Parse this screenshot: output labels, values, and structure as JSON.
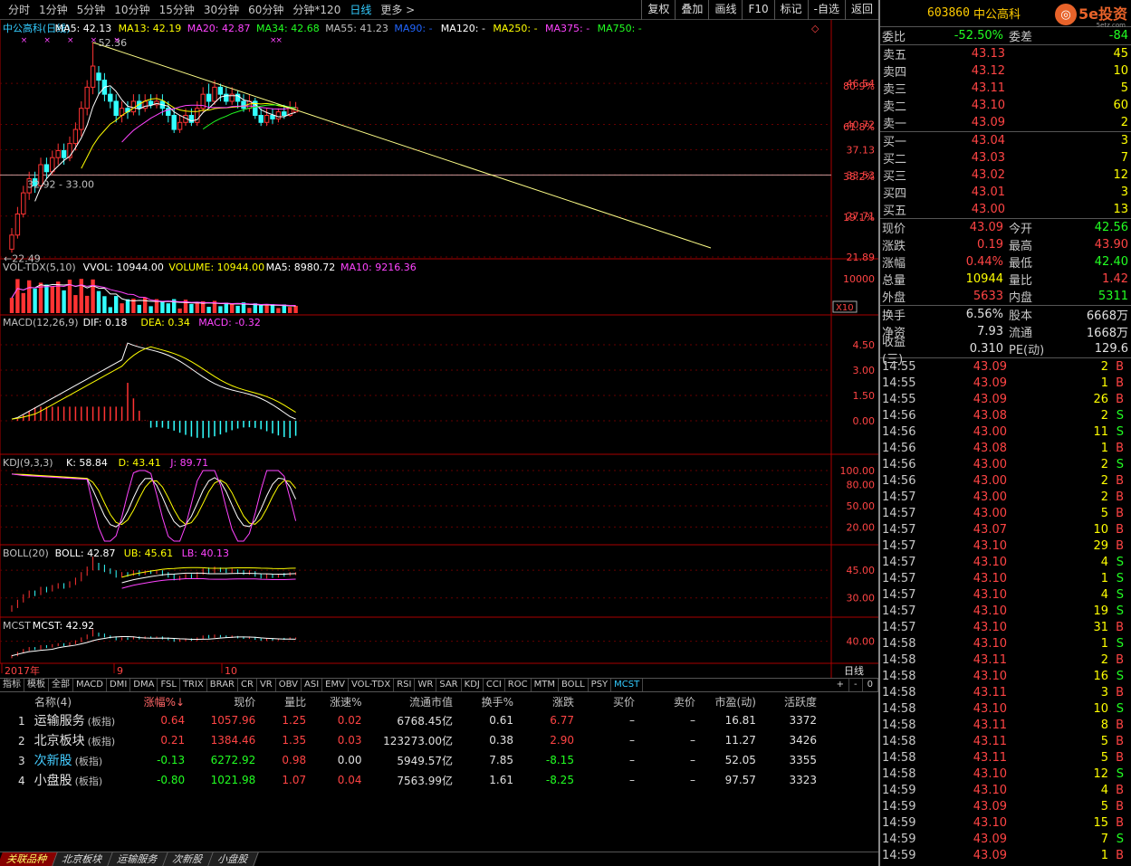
{
  "periods": [
    "分时",
    "1分钟",
    "5分钟",
    "10分钟",
    "15分钟",
    "30分钟",
    "60分钟",
    "分钟*120",
    "日线",
    "更多 >"
  ],
  "active_period": "日线",
  "tools": [
    "复权",
    "叠加",
    "画线",
    "F10",
    "标记",
    "-自选",
    "返回"
  ],
  "main": {
    "legend": [
      {
        "t": "中公高科(日线)",
        "c": "#33ccff"
      },
      {
        "t": "MA5: 42.13",
        "c": "#ffffff"
      },
      {
        "t": "MA13: 42.19",
        "c": "#ffff00"
      },
      {
        "t": "MA20: 42.87",
        "c": "#ff44ff"
      },
      {
        "t": "MA34: 42.68",
        "c": "#22ff22"
      },
      {
        "t": "MA55: 41.23",
        "c": "#c0c0c0"
      },
      {
        "t": "MA90: -",
        "c": "#2266ff"
      },
      {
        "t": "MA120: -",
        "c": "#ffffff"
      },
      {
        "t": "MA250: -",
        "c": "#ffff00"
      },
      {
        "t": "MA375: -",
        "c": "#ff44ff"
      },
      {
        "t": "MA750: -",
        "c": "#22ff22"
      }
    ],
    "high_label": "52.36",
    "low_label": "←22.49",
    "range_label": "32.92 - 33.00",
    "price_ticks": [
      "46.54",
      "40.72",
      "37.13",
      "33.53",
      "27.71",
      "21.89"
    ],
    "pct_ticks": [
      "80.9%",
      "61.8%",
      "38.2%",
      "19.1%"
    ],
    "candles": [
      {
        "o": 23,
        "c": 25,
        "h": 26,
        "l": 22.5
      },
      {
        "o": 25,
        "c": 28,
        "h": 29,
        "l": 24.5
      },
      {
        "o": 28,
        "c": 31,
        "h": 32,
        "l": 27.5
      },
      {
        "o": 31,
        "c": 33,
        "h": 34,
        "l": 30
      },
      {
        "o": 33,
        "c": 32,
        "h": 34,
        "l": 31
      },
      {
        "o": 32,
        "c": 35,
        "h": 36,
        "l": 31.5
      },
      {
        "o": 35,
        "c": 34,
        "h": 36,
        "l": 33
      },
      {
        "o": 34,
        "c": 36,
        "h": 37,
        "l": 33.5
      },
      {
        "o": 36,
        "c": 37,
        "h": 38,
        "l": 35
      },
      {
        "o": 37,
        "c": 36,
        "h": 38,
        "l": 35
      },
      {
        "o": 36,
        "c": 38,
        "h": 39,
        "l": 35.5
      },
      {
        "o": 38,
        "c": 40,
        "h": 41,
        "l": 37
      },
      {
        "o": 40,
        "c": 43,
        "h": 44,
        "l": 39
      },
      {
        "o": 43,
        "c": 46,
        "h": 47,
        "l": 42
      },
      {
        "o": 46,
        "c": 49,
        "h": 52.36,
        "l": 45
      },
      {
        "o": 48,
        "c": 47,
        "h": 49,
        "l": 45
      },
      {
        "o": 47,
        "c": 45,
        "h": 48,
        "l": 44
      },
      {
        "o": 45,
        "c": 44,
        "h": 46,
        "l": 43
      },
      {
        "o": 44,
        "c": 42,
        "h": 45,
        "l": 41
      },
      {
        "o": 42,
        "c": 43,
        "h": 44,
        "l": 41
      },
      {
        "o": 43,
        "c": 42.5,
        "h": 44,
        "l": 41.5
      },
      {
        "o": 42.5,
        "c": 44,
        "h": 45,
        "l": 42
      },
      {
        "o": 44,
        "c": 43,
        "h": 45,
        "l": 42
      },
      {
        "o": 43,
        "c": 44,
        "h": 45,
        "l": 42.5
      },
      {
        "o": 44,
        "c": 43.5,
        "h": 45,
        "l": 43
      },
      {
        "o": 43.5,
        "c": 44,
        "h": 45,
        "l": 43
      },
      {
        "o": 44,
        "c": 43,
        "h": 45,
        "l": 42
      },
      {
        "o": 43,
        "c": 42,
        "h": 44,
        "l": 41
      },
      {
        "o": 42,
        "c": 40,
        "h": 43,
        "l": 39.5
      },
      {
        "o": 40,
        "c": 41,
        "h": 42,
        "l": 39.5
      },
      {
        "o": 41,
        "c": 42,
        "h": 43,
        "l": 40.5
      },
      {
        "o": 42,
        "c": 41,
        "h": 43,
        "l": 40.5
      },
      {
        "o": 41,
        "c": 43,
        "h": 44,
        "l": 40.5
      },
      {
        "o": 43,
        "c": 45,
        "h": 46,
        "l": 42.5
      },
      {
        "o": 45,
        "c": 44,
        "h": 46.5,
        "l": 43
      },
      {
        "o": 44,
        "c": 46,
        "h": 47,
        "l": 43.5
      },
      {
        "o": 46,
        "c": 45,
        "h": 46.5,
        "l": 44
      },
      {
        "o": 45,
        "c": 44,
        "h": 46,
        "l": 43.5
      },
      {
        "o": 44,
        "c": 45,
        "h": 46,
        "l": 43.5
      },
      {
        "o": 45,
        "c": 44,
        "h": 45.5,
        "l": 43
      },
      {
        "o": 44,
        "c": 43,
        "h": 45,
        "l": 42.5
      },
      {
        "o": 43,
        "c": 44,
        "h": 45,
        "l": 42.5
      },
      {
        "o": 44,
        "c": 42,
        "h": 44.5,
        "l": 41.5
      },
      {
        "o": 42,
        "c": 41,
        "h": 43,
        "l": 40.5
      },
      {
        "o": 41,
        "c": 42,
        "h": 43,
        "l": 40.5
      },
      {
        "o": 42,
        "c": 41.5,
        "h": 43,
        "l": 40.8
      },
      {
        "o": 41.5,
        "c": 42.5,
        "h": 43,
        "l": 41
      },
      {
        "o": 42.5,
        "c": 42,
        "h": 43.5,
        "l": 41.5
      },
      {
        "o": 42,
        "c": 43,
        "h": 44,
        "l": 41.8
      },
      {
        "o": 42.5,
        "c": 43.09,
        "h": 43.9,
        "l": 42.4
      }
    ]
  },
  "vol": {
    "legend": [
      {
        "t": "VOL-TDX(5,10)",
        "c": "#c0c0c0"
      },
      {
        "t": "VVOL: 10944.00",
        "c": "#ffffff"
      },
      {
        "t": "VOLUME: 10944.00",
        "c": "#ffff00"
      },
      {
        "t": "MA5: 8980.72",
        "c": "#ffffff"
      },
      {
        "t": "MA10: 9216.36",
        "c": "#ff44ff"
      }
    ],
    "tick": "10000",
    "scale": "X10"
  },
  "macd": {
    "legend": [
      {
        "t": "MACD(12,26,9)",
        "c": "#c0c0c0"
      },
      {
        "t": "DIF: 0.18",
        "c": "#ffffff"
      },
      {
        "t": "DEA: 0.34",
        "c": "#ffff00"
      },
      {
        "t": "MACD: -0.32",
        "c": "#ff44ff"
      }
    ],
    "ticks": [
      "4.50",
      "3.00",
      "1.50",
      "0.00"
    ]
  },
  "kdj": {
    "legend": [
      {
        "t": "KDJ(9,3,3)",
        "c": "#c0c0c0"
      },
      {
        "t": "K: 58.84",
        "c": "#ffffff"
      },
      {
        "t": "D: 43.41",
        "c": "#ffff00"
      },
      {
        "t": "J: 89.71",
        "c": "#ff44ff"
      }
    ],
    "ticks": [
      "100.00",
      "80.00",
      "50.00",
      "20.00"
    ]
  },
  "boll": {
    "legend": [
      {
        "t": "BOLL(20)",
        "c": "#c0c0c0"
      },
      {
        "t": "BOLL: 42.87",
        "c": "#ffffff"
      },
      {
        "t": "UB: 45.61",
        "c": "#ffff00"
      },
      {
        "t": "LB: 40.13",
        "c": "#ff44ff"
      }
    ],
    "ticks": [
      "45.00",
      "30.00"
    ]
  },
  "mcst": {
    "legend": [
      {
        "t": "MCST",
        "c": "#c0c0c0"
      },
      {
        "t": "MCST: 42.92",
        "c": "#ffffff"
      }
    ],
    "ticks": [
      "40.00"
    ]
  },
  "xaxis": {
    "labels": [
      "2017年",
      "9",
      "10"
    ],
    "right": "日线"
  },
  "indicator_tabs": [
    "指标",
    "模板",
    "全部",
    "MACD",
    "DMI",
    "DMA",
    "FSL",
    "TRIX",
    "BRAR",
    "CR",
    "VR",
    "OBV",
    "ASI",
    "EMV",
    "VOL-TDX",
    "RSI",
    "WR",
    "SAR",
    "KDJ",
    "CCI",
    "ROC",
    "MTM",
    "BOLL",
    "PSY",
    "MCST"
  ],
  "active_indicator": "MCST",
  "tab_controls": [
    "+",
    "-",
    "0"
  ],
  "blocks": {
    "headers": [
      "名称(4)",
      "涨幅%↓",
      "现价",
      "量比",
      "涨速%",
      "流通市值",
      "换手%",
      "涨跌",
      "买价",
      "卖价",
      "市盈(动)",
      "活跃度"
    ],
    "rows": [
      {
        "no": "1",
        "name": "运输服务",
        "tag": "(板指)",
        "chg": "0.64",
        "price": "1057.96",
        "vr": "1.25",
        "speed": "0.02",
        "mcap": "6768.45亿",
        "turn": "0.61",
        "diff": "6.77",
        "bid": "–",
        "ask": "–",
        "pe": "16.81",
        "act": "3372",
        "dir": "up"
      },
      {
        "no": "2",
        "name": "北京板块",
        "tag": "(板指)",
        "chg": "0.21",
        "price": "1384.46",
        "vr": "1.35",
        "speed": "0.03",
        "mcap": "123273.00亿",
        "turn": "0.38",
        "diff": "2.90",
        "bid": "–",
        "ask": "–",
        "pe": "11.27",
        "act": "3426",
        "dir": "up"
      },
      {
        "no": "3",
        "name": "次新股",
        "tag": "(板指)",
        "chg": "-0.13",
        "price": "6272.92",
        "vr": "0.98",
        "speed": "0.00",
        "mcap": "5949.57亿",
        "turn": "7.85",
        "diff": "-8.15",
        "bid": "–",
        "ask": "–",
        "pe": "52.05",
        "act": "3355",
        "dir": "down"
      },
      {
        "no": "4",
        "name": "小盘股",
        "tag": "(板指)",
        "chg": "-0.80",
        "price": "1021.98",
        "vr": "1.07",
        "speed": "0.04",
        "mcap": "7563.99亿",
        "turn": "1.61",
        "diff": "-8.25",
        "bid": "–",
        "ask": "–",
        "pe": "97.57",
        "act": "3323",
        "dir": "down"
      }
    ]
  },
  "bottom_tabs": [
    "关联品种",
    "北京板块",
    "运输服务",
    "次新股",
    "小盘股"
  ],
  "stock": {
    "code": "603860",
    "name": "中公高科",
    "logo": "5e投资",
    "logo_sub": "5etz.com",
    "ratio": {
      "l": "委比",
      "v": "-52.50%",
      "l2": "委差",
      "v2": "-84"
    },
    "asks": [
      {
        "l": "卖五",
        "p": "43.13",
        "n": "45"
      },
      {
        "l": "卖四",
        "p": "43.12",
        "n": "10"
      },
      {
        "l": "卖三",
        "p": "43.11",
        "n": "5"
      },
      {
        "l": "卖二",
        "p": "43.10",
        "n": "60"
      },
      {
        "l": "卖一",
        "p": "43.09",
        "n": "2"
      }
    ],
    "bids": [
      {
        "l": "买一",
        "p": "43.04",
        "n": "3"
      },
      {
        "l": "买二",
        "p": "43.03",
        "n": "7"
      },
      {
        "l": "买三",
        "p": "43.02",
        "n": "12"
      },
      {
        "l": "买四",
        "p": "43.01",
        "n": "3"
      },
      {
        "l": "买五",
        "p": "43.00",
        "n": "13"
      }
    ],
    "quote": [
      {
        "l": "现价",
        "v": "43.09",
        "vc": "red",
        "l2": "今开",
        "v2": "42.56",
        "v2c": "grn"
      },
      {
        "l": "涨跌",
        "v": "0.19",
        "vc": "red",
        "l2": "最高",
        "v2": "43.90",
        "v2c": "red"
      },
      {
        "l": "涨幅",
        "v": "0.44%",
        "vc": "red",
        "l2": "最低",
        "v2": "42.40",
        "v2c": "grn"
      },
      {
        "l": "总量",
        "v": "10944",
        "vc": "yel",
        "l2": "量比",
        "v2": "1.42",
        "v2c": "red"
      },
      {
        "l": "外盘",
        "v": "5633",
        "vc": "red",
        "l2": "内盘",
        "v2": "5311",
        "v2c": "grn"
      }
    ],
    "quote2": [
      {
        "l": "换手",
        "v": "6.56%",
        "vc": "wht",
        "l2": "股本",
        "v2": "6668万",
        "v2c": "wht"
      },
      {
        "l": "净资",
        "v": "7.93",
        "vc": "wht",
        "l2": "流通",
        "v2": "1668万",
        "v2c": "wht"
      },
      {
        "l": "收益(三)",
        "v": "0.310",
        "vc": "wht",
        "l2": "PE(动)",
        "v2": "129.6",
        "v2c": "wht"
      }
    ],
    "ticks": [
      [
        "14:55",
        "43.09",
        "2",
        "B"
      ],
      [
        "14:55",
        "43.09",
        "1",
        "B"
      ],
      [
        "14:55",
        "43.09",
        "26",
        "B"
      ],
      [
        "14:56",
        "43.08",
        "2",
        "S"
      ],
      [
        "14:56",
        "43.00",
        "11",
        "S"
      ],
      [
        "14:56",
        "43.08",
        "1",
        "B"
      ],
      [
        "14:56",
        "43.00",
        "2",
        "S"
      ],
      [
        "14:56",
        "43.00",
        "2",
        "B"
      ],
      [
        "14:57",
        "43.00",
        "2",
        "B"
      ],
      [
        "14:57",
        "43.00",
        "5",
        "B"
      ],
      [
        "14:57",
        "43.07",
        "10",
        "B"
      ],
      [
        "14:57",
        "43.10",
        "29",
        "B"
      ],
      [
        "14:57",
        "43.10",
        "4",
        "S"
      ],
      [
        "14:57",
        "43.10",
        "1",
        "S"
      ],
      [
        "14:57",
        "43.10",
        "4",
        "S"
      ],
      [
        "14:57",
        "43.10",
        "19",
        "S"
      ],
      [
        "14:57",
        "43.10",
        "31",
        "B"
      ],
      [
        "14:58",
        "43.10",
        "1",
        "S"
      ],
      [
        "14:58",
        "43.11",
        "2",
        "B"
      ],
      [
        "14:58",
        "43.10",
        "16",
        "S"
      ],
      [
        "14:58",
        "43.11",
        "3",
        "B"
      ],
      [
        "14:58",
        "43.10",
        "10",
        "S"
      ],
      [
        "14:58",
        "43.11",
        "8",
        "B"
      ],
      [
        "14:58",
        "43.11",
        "5",
        "B"
      ],
      [
        "14:58",
        "43.11",
        "5",
        "B"
      ],
      [
        "14:58",
        "43.10",
        "12",
        "S"
      ],
      [
        "14:59",
        "43.10",
        "4",
        "B"
      ],
      [
        "14:59",
        "43.09",
        "5",
        "B"
      ],
      [
        "14:59",
        "43.10",
        "15",
        "B"
      ],
      [
        "14:59",
        "43.09",
        "7",
        "S"
      ],
      [
        "14:59",
        "43.09",
        "1",
        "B"
      ]
    ]
  }
}
